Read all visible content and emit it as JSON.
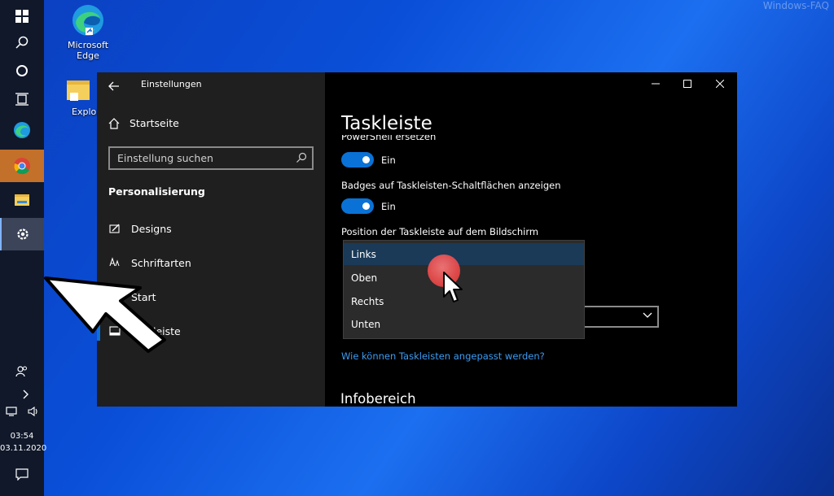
{
  "watermark": "Windows-FAQ",
  "desktop": {
    "icons": [
      {
        "label": "Microsoft Edge",
        "icon": "edge-icon"
      },
      {
        "label": "Explor",
        "icon": "folder-icon"
      }
    ]
  },
  "taskbar": {
    "items": [
      "windows-start-icon",
      "search-icon",
      "cortana-icon",
      "task-view-icon",
      "edge-icon",
      "chrome-icon",
      "file-explorer-icon",
      "settings-gear-icon"
    ],
    "tray": {
      "time": "03:54",
      "date": "03.11.2020"
    }
  },
  "window": {
    "title": "Einstellungen",
    "sidebar": {
      "home": "Startseite",
      "search_placeholder": "Einstellung suchen",
      "section": "Personalisierung",
      "items": [
        {
          "label": "Designs",
          "icon": "designs-icon"
        },
        {
          "label": "Schriftarten",
          "icon": "fonts-icon"
        },
        {
          "label": "Start",
          "icon": "start-icon"
        },
        {
          "label": "Taskleiste",
          "icon": "taskbar-icon",
          "selected": true
        }
      ]
    },
    "main": {
      "title": "Taskleiste",
      "cut_label": "PowerShell ersetzen",
      "toggle1_state": "Ein",
      "badges_label": "Badges auf Taskleisten-Schaltflächen anzeigen",
      "toggle2_state": "Ein",
      "position_label": "Position der Taskleiste auf dem Bildschirm",
      "dropdown_options": [
        "Links",
        "Oben",
        "Rechts",
        "Unten"
      ],
      "selected_option": "Links",
      "link": "Wie können Taskleisten angepasst werden?",
      "subheading": "Infobereich"
    },
    "accent_color": "#0a72d6"
  }
}
